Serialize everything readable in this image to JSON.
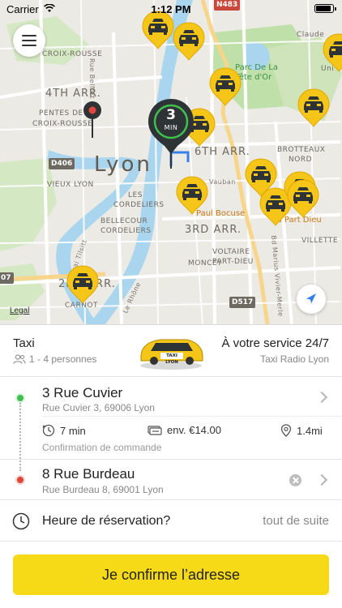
{
  "status_bar": {
    "carrier": "Carrier",
    "time": "1:12 PM",
    "battery_level": 0.9
  },
  "map": {
    "labels": {
      "croix_rousse": "CROIX-ROUSSE",
      "arr4": "4TH ARR.",
      "pentes": "PENTES DE LA",
      "croix_rousse2": "CROIX-ROUSSE",
      "city": "Lyon",
      "vieux_lyon": "VIEUX LYON",
      "les_cordeliers": "LES",
      "les_cordeliers2": "CORDELIERS",
      "bellecour": "BELLECOUR",
      "bellecour2": "CORDELIERS",
      "arr6": "6TH ARR.",
      "arr3": "3RD ARR.",
      "arr2": "2ND ARR.",
      "brotteaux": "BROTTEAUX",
      "brotteaux2": "NORD",
      "moncey": "MONCEY",
      "voltaire": "VOLTAIRE",
      "part_dieu": "PART-DIEU",
      "villette": "VILLETTE",
      "carnot": "CARNOT",
      "claude": "Claude",
      "ainsi": "Uni",
      "parc": "Parc De La",
      "tete_or": "Tête d'Or",
      "vauban": "Vauban",
      "paul_bocuse": "Paul Bocuse",
      "part_dieu_poi": "La Part Dieu",
      "rue_belfort": "Rue Belfort",
      "quai_tilsitt": "Quai Tilsitt",
      "le_rhone": "Le Rhône",
      "bd_marius": "Bd Marius Vivier-Merle"
    },
    "road_badges": {
      "n483": "N483",
      "d406": "D406",
      "d517": "D517",
      "d07": "07"
    },
    "legal": "Legal",
    "eta": {
      "value": "3",
      "unit": "MIN"
    }
  },
  "service": {
    "name": "Taxi",
    "capacity": "1 - 4 personnes",
    "car_text": "TAXI LYON",
    "slogan": "À votre service 24/7",
    "company": "Taxi Radio Lyon"
  },
  "pickup": {
    "title": "3 Rue Cuvier",
    "address": "Rue Cuvier 3, 69006 Lyon",
    "duration": "7 min",
    "price": "env. €14.00",
    "distance": "1.4mi",
    "note": "Confirmation de commande"
  },
  "dropoff": {
    "title": "8 Rue Burdeau",
    "address": "Rue Burdeau 8, 69001 Lyon"
  },
  "reservation": {
    "label": "Heure de réservation?",
    "value": "tout de suite"
  },
  "confirm_button": "Je confirme l’adresse",
  "colors": {
    "accent_yellow": "#f6d917",
    "pin_yellow": "#f5c518",
    "river": "#a9d6ee",
    "park": "#bfe0a8",
    "pickup_green": "#3fbf4f",
    "dropoff_red": "#e0473b"
  }
}
